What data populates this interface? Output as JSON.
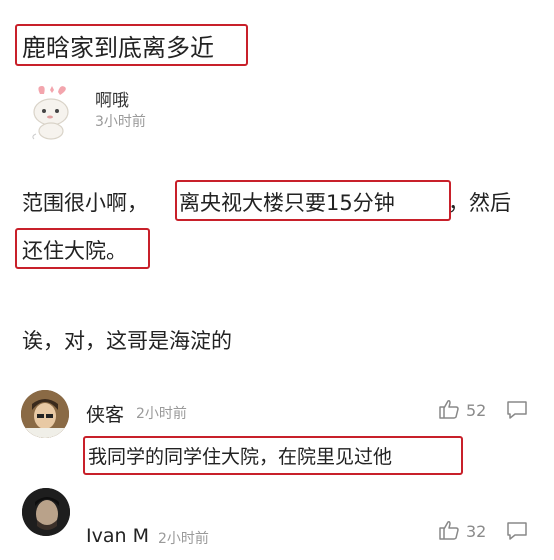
{
  "post": {
    "title": "鹿晗家到底离多近",
    "author": "啊哦",
    "time": "3小时前",
    "body_pre": "范围很小啊，",
    "body_hl1": "离央视大楼只要15分钟",
    "body_post": "，然后",
    "body_hl2": "还住大院。",
    "reply": "诶，对，这哥是海淀的"
  },
  "comments": [
    {
      "name": "侠客",
      "time": "2小时前",
      "likes": "52",
      "text": "我同学的同学住大院，在院里见过他"
    },
    {
      "name": "Ivan M",
      "time": "2小时前",
      "likes": "32"
    }
  ],
  "colors": {
    "highlight_border": "#c8202a",
    "muted_text": "#9a9a9a"
  }
}
